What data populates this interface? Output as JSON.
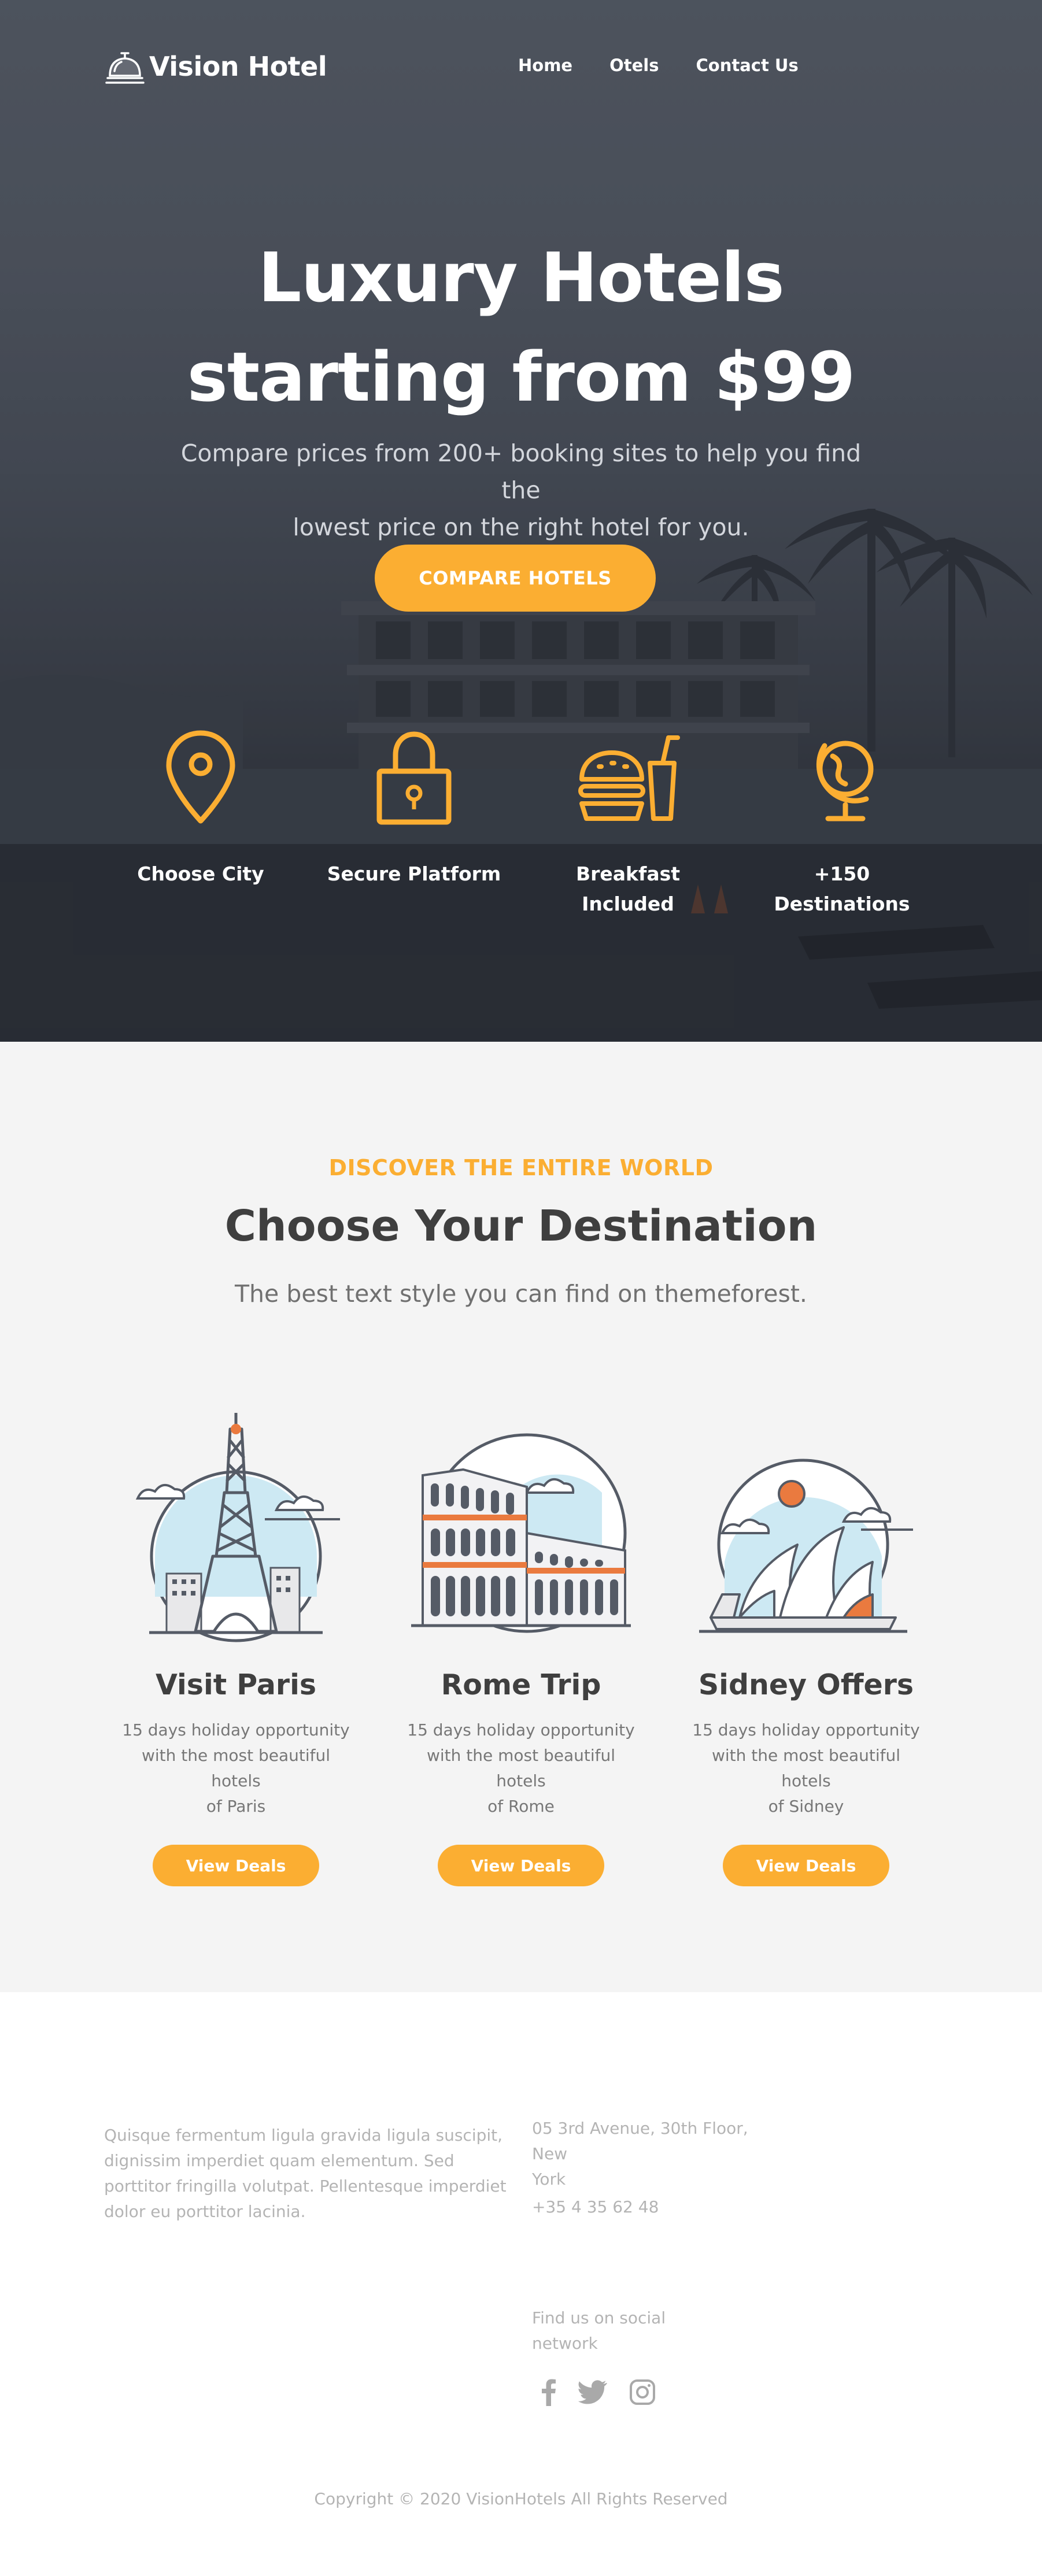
{
  "brand": {
    "name": "Vision Hotel"
  },
  "nav": {
    "items": [
      "Home",
      "Otels",
      "Contact Us"
    ]
  },
  "hero": {
    "title_line1": "Luxury Hotels",
    "title_line2": "starting from $99",
    "subtitle_line1": "Compare prices from 200+ booking sites to help you find the",
    "subtitle_line2": "lowest price on the right hotel for you.",
    "cta": "COMPARE HOTELS"
  },
  "features": [
    {
      "label_line1": "Choose City",
      "label_line2": "",
      "icon": "map-pin-icon"
    },
    {
      "label_line1": "Secure Platform",
      "label_line2": "",
      "icon": "padlock-icon"
    },
    {
      "label_line1": "Breakfast",
      "label_line2": "Included",
      "icon": "burger-drink-icon"
    },
    {
      "label_line1": "+150",
      "label_line2": "Destinations",
      "icon": "globe-icon"
    }
  ],
  "destinations": {
    "eyebrow": "DISCOVER THE ENTIRE WORLD",
    "title": "Choose Your Destination",
    "subtitle": "The best text style you can find on themeforest.",
    "cards": [
      {
        "title": "Visit Paris",
        "desc_line1": "15 days holiday opportunity",
        "desc_line2": "with the most beautiful hotels",
        "desc_line3": "of Paris",
        "button": "View Deals",
        "icon": "eiffel-tower-icon"
      },
      {
        "title": "Rome Trip",
        "desc_line1": "15 days holiday opportunity",
        "desc_line2": "with the most beautiful hotels",
        "desc_line3": "of Rome",
        "button": "View Deals",
        "icon": "colosseum-icon"
      },
      {
        "title": "Sidney Offers",
        "desc_line1": "15 days holiday opportunity",
        "desc_line2": "with the most beautiful hotels",
        "desc_line3": "of Sidney",
        "button": "View Deals",
        "icon": "opera-house-icon"
      }
    ]
  },
  "footer": {
    "about": "Quisque fermentum ligula gravida ligula suscipit, dignissim imperdiet quam elementum. Sed porttitor fringilla volutpat. Pellentesque imperdiet dolor eu porttitor lacinia.",
    "address_line1": "05 3rd Avenue, 30th Floor, New",
    "address_line2": "York",
    "phone": "+35 4 35 62 48",
    "social_line1": "Find us on social",
    "social_line2": "network",
    "social_icons": [
      "facebook-icon",
      "twitter-icon",
      "instagram-icon"
    ],
    "copyright": "Copyright © 2020 VisionHotels All Rights Reserved"
  },
  "colors": {
    "accent": "#fbae32",
    "hero_dark": "#3e434d",
    "section_bg": "#f4f4f4",
    "muted_text": "#b4b4b4",
    "heading": "#3f3f3f"
  }
}
